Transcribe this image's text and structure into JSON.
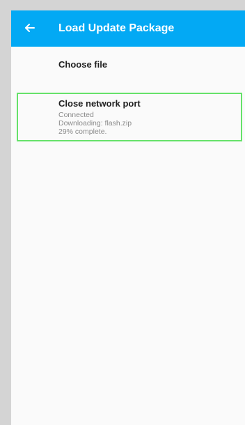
{
  "app_bar": {
    "title": "Load Update Package",
    "back_icon": "arrow-left-icon",
    "background_color": "#03a9f4"
  },
  "items": {
    "choose_file": {
      "label": "Choose file"
    },
    "network_port": {
      "label": "Close network port",
      "status_lines": [
        "Connected",
        "Downloading: flash.zip",
        "29% complete."
      ],
      "highlight_color": "#66e26a"
    }
  }
}
